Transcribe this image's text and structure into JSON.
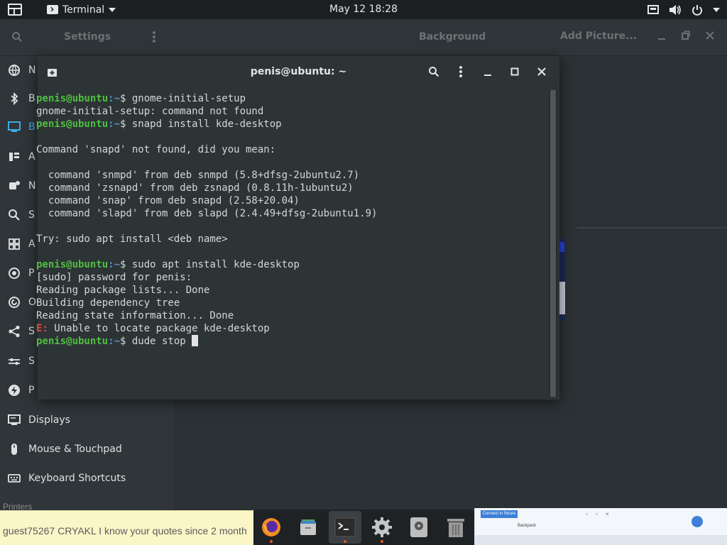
{
  "topbar": {
    "app_name": "Terminal",
    "clock": "May 12  18:28"
  },
  "settings": {
    "title": "Settings",
    "background_title": "Background",
    "add_picture": "Add Picture...",
    "sidebar": [
      {
        "label": "N",
        "icon": "network-icon"
      },
      {
        "label": "B",
        "icon": "bluetooth-icon"
      },
      {
        "label": "B",
        "icon": "background-icon",
        "active": true
      },
      {
        "label": "A",
        "icon": "appearance-icon"
      },
      {
        "label": "N",
        "icon": "notifications-icon"
      },
      {
        "label": "S",
        "icon": "search-icon"
      },
      {
        "label": "A",
        "icon": "applications-icon"
      },
      {
        "label": "P",
        "icon": "privacy-icon"
      },
      {
        "label": "O",
        "icon": "online-accounts-icon"
      },
      {
        "label": "S",
        "icon": "sharing-icon"
      },
      {
        "label": "S",
        "icon": "sound-icon"
      },
      {
        "label": "P",
        "icon": "power-icon"
      },
      {
        "label": "Displays",
        "icon": "displays-icon"
      },
      {
        "label": "Mouse & Touchpad",
        "icon": "mouse-icon"
      },
      {
        "label": "Keyboard Shortcuts",
        "icon": "keyboard-icon"
      },
      {
        "label": "Printers",
        "icon": "printer-icon"
      }
    ]
  },
  "terminal": {
    "title": "penis@ubuntu: ~",
    "user_host": "penis@ubuntu",
    "path_suffix": ":~",
    "lines": [
      {
        "type": "prompt",
        "text": "$ gnome-initial-setup"
      },
      {
        "type": "out",
        "text": "gnome-initial-setup: command not found"
      },
      {
        "type": "prompt",
        "text": "$ snapd install kde-desktop"
      },
      {
        "type": "out",
        "text": ""
      },
      {
        "type": "out",
        "text": "Command 'snapd' not found, did you mean:"
      },
      {
        "type": "out",
        "text": ""
      },
      {
        "type": "out",
        "text": "  command 'snmpd' from deb snmpd (5.8+dfsg-2ubuntu2.7)"
      },
      {
        "type": "out",
        "text": "  command 'zsnapd' from deb zsnapd (0.8.11h-1ubuntu2)"
      },
      {
        "type": "out",
        "text": "  command 'snap' from deb snapd (2.58+20.04)"
      },
      {
        "type": "out",
        "text": "  command 'slapd' from deb slapd (2.4.49+dfsg-2ubuntu1.9)"
      },
      {
        "type": "out",
        "text": ""
      },
      {
        "type": "out",
        "text": "Try: sudo apt install <deb name>"
      },
      {
        "type": "out",
        "text": ""
      },
      {
        "type": "prompt",
        "text": "$ sudo apt install kde-desktop"
      },
      {
        "type": "out",
        "text": "[sudo] password for penis:"
      },
      {
        "type": "out",
        "text": "Reading package lists... Done"
      },
      {
        "type": "out",
        "text": "Building dependency tree"
      },
      {
        "type": "out",
        "text": "Reading state information... Done"
      },
      {
        "type": "error",
        "tag": "E:",
        "text": " Unable to locate package kde-desktop"
      },
      {
        "type": "prompt",
        "text": "$ dude stop ",
        "cursor": true
      }
    ]
  },
  "chat": {
    "top_text": "Printers",
    "user": "guest75267",
    "message": " CRYAKL I know your quotes since 2 month"
  },
  "dock": [
    {
      "name": "firefox-icon",
      "running": true
    },
    {
      "name": "files-icon",
      "running": false
    },
    {
      "name": "terminal-icon",
      "running": true,
      "active": true
    },
    {
      "name": "settings-icon",
      "running": true
    },
    {
      "name": "disk-icon",
      "running": false
    },
    {
      "name": "trash-icon",
      "running": false
    }
  ],
  "thumb": {
    "tab_label": "Connect in fixture",
    "sub_label": "Backpack"
  },
  "colors": {
    "prompt_green": "#4fbf3f",
    "path_blue": "#5c8fd0",
    "error_red": "#e04646",
    "accent": "#3daee9",
    "ubuntu_orange": "#e95420"
  }
}
